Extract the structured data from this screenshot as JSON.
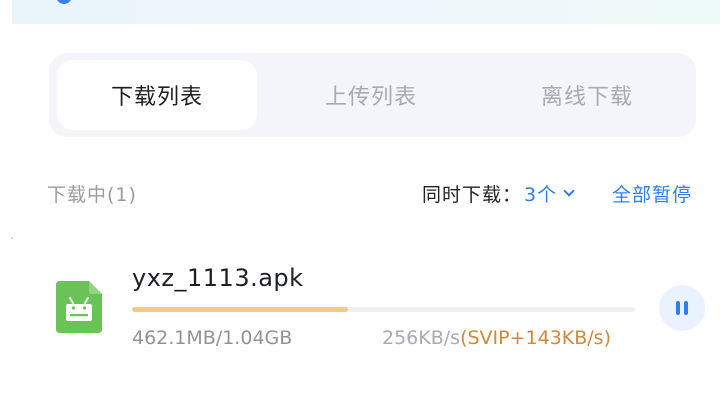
{
  "tabs": [
    {
      "label": "下载列表",
      "active": true
    },
    {
      "label": "上传列表",
      "active": false
    },
    {
      "label": "离线下载",
      "active": false
    }
  ],
  "status": {
    "downloading_label": "下载中(1)",
    "concurrent_label": "同时下载：",
    "concurrent_value": "3个",
    "pause_all_label": "全部暂停"
  },
  "downloads": [
    {
      "file_name": "yxz_1113.apk",
      "icon": "android-apk-file-icon",
      "progress": 0.43,
      "size_text": "462.1MB/1.04GB",
      "speed": "256KB/s",
      "svip_speed": "(SVIP+143KB/s)"
    }
  ],
  "colors": {
    "accent": "#2d7ff0",
    "progress": "#f4c889",
    "svip": "#d0893a",
    "apk_icon": "#6ac259"
  }
}
